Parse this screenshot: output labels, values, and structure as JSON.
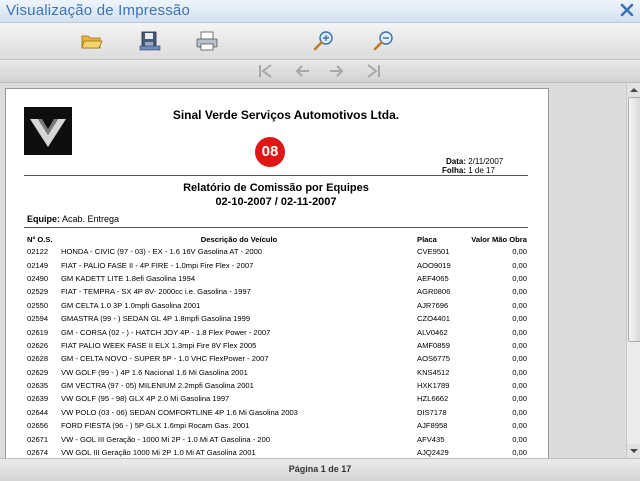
{
  "window": {
    "title": "Visualização de Impressão"
  },
  "toolbar": {
    "icons": [
      "folder-open-icon",
      "save-icon",
      "print-icon",
      "zoom-in-icon",
      "zoom-out-icon"
    ]
  },
  "navigation": {
    "icons": [
      "first-page-icon",
      "previous-page-icon",
      "next-page-icon",
      "last-page-icon"
    ]
  },
  "report": {
    "company": "Sinal Verde Serviços Automotivos Ltda.",
    "badge": "08",
    "date_label": "Data:",
    "date_value": "2/11/2007",
    "sheet_label": "Folha:",
    "sheet_value": "1 de 17",
    "title": "Relatório de Comissão por Equipes",
    "period": "02-10-2007 / 02-11-2007",
    "team_label": "Equipe:",
    "team_value": "Acab. Entrega",
    "columns": [
      "Nº O.S.",
      "Descrição do Veículo",
      "Placa",
      "Valor Mão Obra"
    ],
    "rows": [
      [
        "02122",
        "HONDA - CIVIC (97 - 03) - EX - 1.6 16V Gasolina AT - 2000",
        "CVE9501",
        "0,00"
      ],
      [
        "02149",
        "FIAT - PALIO FASE II - 4P FIRE - 1.0mpi Fire Flex - 2007",
        "AOO9019",
        "0,00"
      ],
      [
        "02490",
        "GM KADETT LITE 1.8efi Gasolina 1994",
        "AEF4065",
        "0,00"
      ],
      [
        "02529",
        "FIAT - TEMPRA - SX 4P 8V- 2000cc i.e. Gasolina - 1997",
        "AGR0806",
        "0,00"
      ],
      [
        "02550",
        "GM CELTA 1.0 3P 1.0mpfi Gasolina 2001",
        "AJR7696",
        "0,00"
      ],
      [
        "02594",
        "GMASTRA (99 - ) SEDAN GL 4P 1.8mpfi Gasolina 1999",
        "CZO4401",
        "0,00"
      ],
      [
        "02619",
        "GM - CORSA (02 - ) - HATCH JOY 4P - 1.8 Flex Power - 2007",
        "ALV0462",
        "0,00"
      ],
      [
        "02626",
        "FIAT PALIO WEEK FASE II ELX 1.3mpi Fire 8V Flex 2005",
        "AMF0859",
        "0,00"
      ],
      [
        "02628",
        "GM - CELTA NOVO - SUPER 5P - 1.0 VHC FlexPower - 2007",
        "AOS6775",
        "0,00"
      ],
      [
        "02629",
        "VW GOLF (99 - ) 4P 1.6 Nacional 1.6 Mi Gasolina 2001",
        "KNS4512",
        "0,00"
      ],
      [
        "02635",
        "GM VECTRA (97 - 05) MILENIUM 2.2mpfi Gasolina 2001",
        "HXK1789",
        "0,00"
      ],
      [
        "02639",
        "VW GOLF (95 - 98) GLX 4P 2.0 Mi Gasolina 1997",
        "HZL6662",
        "0,00"
      ],
      [
        "02644",
        "VW POLO (03 - 06) SEDAN COMFORTLINE 4P 1.6 Mi Gasolina 2003",
        "DIS7178",
        "0,00"
      ],
      [
        "02656",
        "FORD FIESTA (96 - ) 5P GLX 1.6mpi Rocam Gas. 2001",
        "AJF8958",
        "0,00"
      ],
      [
        "02671",
        "VW - GOL III Geração - 1000 Mi 2P - 1.0 Mi AT Gasolina - 200",
        "AFV435",
        "0,00"
      ],
      [
        "02674",
        "VW GOL III Geração 1000 Mi 2P 1.0 Mi AT Gasolina 2001",
        "AJQ2429",
        "0,00"
      ]
    ]
  },
  "status": {
    "page": "Página 1 de 17"
  }
}
